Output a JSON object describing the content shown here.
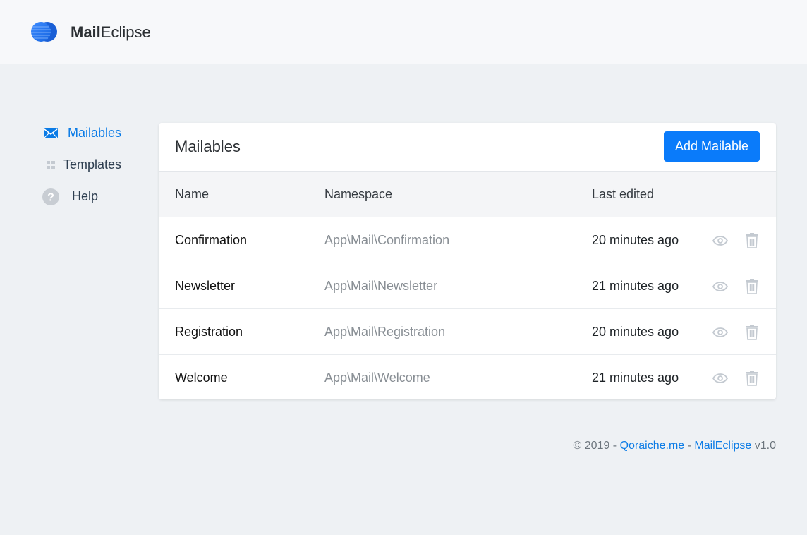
{
  "app": {
    "brand_bold": "Mail",
    "brand_rest": "Eclipse",
    "logo_icon": "eclipse-logo-icon"
  },
  "sidebar": {
    "items": [
      {
        "label": "Mailables",
        "icon": "envelope-icon",
        "active": true
      },
      {
        "label": "Templates",
        "icon": "grid-icon",
        "active": false
      },
      {
        "label": "Help",
        "icon": "question-circle-icon",
        "active": false
      }
    ]
  },
  "card": {
    "title": "Mailables",
    "add_button_label": "Add Mailable"
  },
  "table": {
    "headers": [
      "Name",
      "Namespace",
      "Last edited"
    ],
    "rows": [
      {
        "name": "Confirmation",
        "namespace": "App\\Mail\\Confirmation",
        "last_edited": "20 minutes ago"
      },
      {
        "name": "Newsletter",
        "namespace": "App\\Mail\\Newsletter",
        "last_edited": "21 minutes ago"
      },
      {
        "name": "Registration",
        "namespace": "App\\Mail\\Registration",
        "last_edited": "20 minutes ago"
      },
      {
        "name": "Welcome",
        "namespace": "App\\Mail\\Welcome",
        "last_edited": "21 minutes ago"
      }
    ]
  },
  "footer": {
    "copyright": "© 2019 - ",
    "link1": "Qoraiche.me",
    "separator": " - ",
    "link2": "MailEclipse",
    "version": " v1.0"
  },
  "colors": {
    "accent": "#0a7bfa",
    "active_nav": "#0a7be6",
    "background": "#eef1f4",
    "icon_muted": "#c4cad1"
  }
}
